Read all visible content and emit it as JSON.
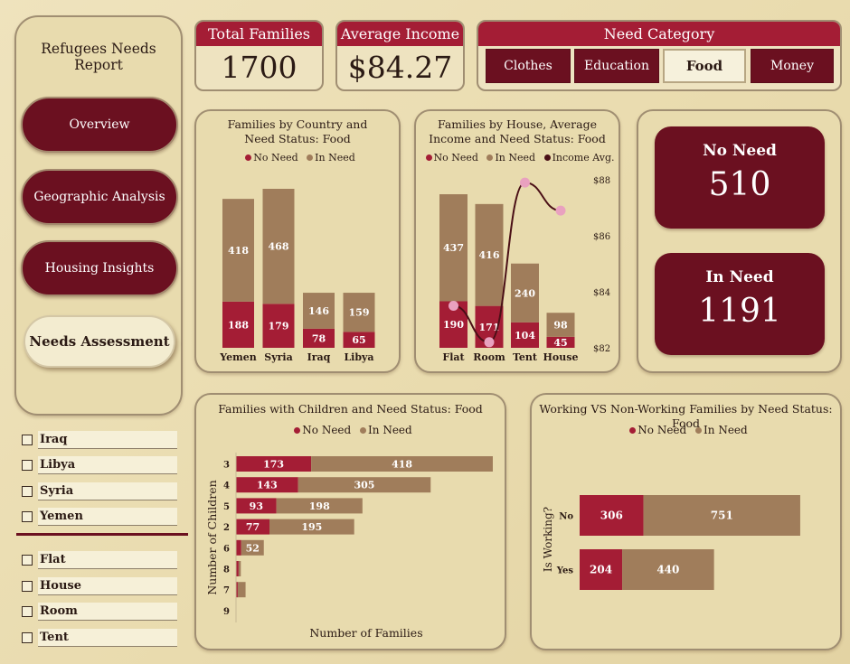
{
  "sidebar": {
    "title": "Refugees Needs Report",
    "nav": [
      {
        "label": "Overview",
        "active": false
      },
      {
        "label": "Geographic Analysis",
        "active": false
      },
      {
        "label": "Housing Insights",
        "active": false
      },
      {
        "label": "Needs Assessment",
        "active": true
      }
    ]
  },
  "slicers": {
    "countries": [
      "Iraq",
      "Libya",
      "Syria",
      "Yemen"
    ],
    "houses": [
      "Flat",
      "House",
      "Room",
      "Tent"
    ]
  },
  "kpis": {
    "total_families": {
      "label": "Total Families",
      "value": "1700"
    },
    "average_income": {
      "label": "Average Income",
      "value": "$84.27"
    }
  },
  "need_category": {
    "title": "Need Category",
    "options": [
      "Clothes",
      "Education",
      "Food",
      "Money"
    ],
    "selected": "Food"
  },
  "stats": {
    "no_need": {
      "label": "No Need",
      "value": "510"
    },
    "in_need": {
      "label": "In Need",
      "value": "1191"
    }
  },
  "colors": {
    "no_need": "#a41d35",
    "in_need": "#a07d5b",
    "income": "#4a0f16",
    "income_marker": "#e9a1bf",
    "dark_button": "#6b1020"
  },
  "chart_data": [
    {
      "id": "country",
      "type": "bar",
      "title": "Families by Country and Need Status: Food",
      "legend": [
        "No Need",
        "In Need"
      ],
      "categories": [
        "Yemen",
        "Syria",
        "Iraq",
        "Libya"
      ],
      "series": [
        {
          "name": "No Need",
          "values": [
            188,
            179,
            78,
            65
          ]
        },
        {
          "name": "In Need",
          "values": [
            418,
            468,
            146,
            159
          ]
        }
      ],
      "stacked": true
    },
    {
      "id": "house",
      "type": "bar",
      "title": "Families by House, Average Income and Need Status: Food",
      "legend": [
        "No Need",
        "In Need",
        "Income Avg."
      ],
      "categories": [
        "Flat",
        "Room",
        "Tent",
        "House"
      ],
      "series": [
        {
          "name": "No Need",
          "values": [
            190,
            171,
            104,
            45
          ]
        },
        {
          "name": "In Need",
          "values": [
            437,
            416,
            240,
            98
          ]
        }
      ],
      "line": {
        "name": "Income Avg.",
        "values": [
          83.5,
          82.2,
          87.9,
          86.9
        ]
      },
      "y2_ticks": [
        "$88",
        "$86",
        "$84",
        "$82"
      ],
      "y2lim": [
        82,
        88
      ],
      "stacked": true
    },
    {
      "id": "children",
      "type": "bar",
      "orientation": "horizontal",
      "title": "Families with Children and Need Status: Food",
      "legend": [
        "No Need",
        "In Need"
      ],
      "categories": [
        "3",
        "4",
        "5",
        "2",
        "6",
        "8",
        "7",
        "9"
      ],
      "series": [
        {
          "name": "No Need",
          "values": [
            173,
            143,
            93,
            77,
            12,
            6,
            4,
            1
          ]
        },
        {
          "name": "In Need",
          "values": [
            418,
            305,
            198,
            195,
            52,
            5,
            18,
            0
          ]
        }
      ],
      "xlabel": "Number of Families",
      "ylabel": "Number of Children",
      "stacked": true
    },
    {
      "id": "working",
      "type": "bar",
      "orientation": "horizontal",
      "title": "Working VS Non-Working Families by Need Status: Food",
      "legend": [
        "No Need",
        "In Need"
      ],
      "categories": [
        "No",
        "Yes"
      ],
      "series": [
        {
          "name": "No Need",
          "values": [
            306,
            204
          ]
        },
        {
          "name": "In Need",
          "values": [
            751,
            440
          ]
        }
      ],
      "ylabel": "Is Working?",
      "stacked": true
    }
  ]
}
